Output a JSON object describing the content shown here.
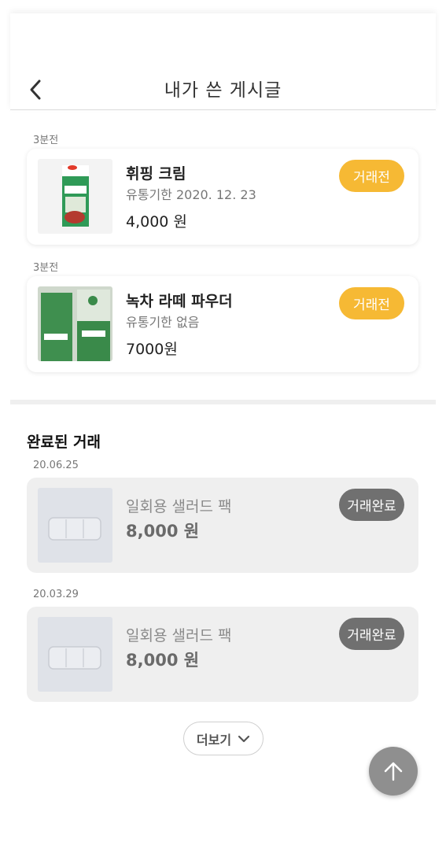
{
  "header": {
    "title": "내가 쓴 게시글",
    "back_icon": "chevron-left-icon"
  },
  "active_posts": [
    {
      "time": "3분전",
      "name": "휘핑 크림",
      "expiry": "유통기한 2020. 12. 23",
      "price": "4,000 원",
      "status": "거래전"
    },
    {
      "time": "3분전",
      "name": "녹차 라떼 파우더",
      "expiry": "유통기한 없음",
      "price": "7000원",
      "status": "거래전"
    }
  ],
  "completed": {
    "title": "완료된 거래",
    "items": [
      {
        "date": "20.06.25",
        "name": "일회용 샐러드 팩",
        "price": "8,000 원",
        "status": "거래완료"
      },
      {
        "date": "20.03.29",
        "name": "일회용 샐러드 팩",
        "price": "8,000 원",
        "status": "거래완료"
      }
    ]
  },
  "more_button": {
    "label": "더보기",
    "icon": "chevron-down-icon"
  },
  "scroll_top": {
    "icon": "arrow-up-icon"
  },
  "colors": {
    "status_pre": "#f6b934",
    "status_complete": "#707070",
    "scroll_top": "#8f8f8f"
  }
}
